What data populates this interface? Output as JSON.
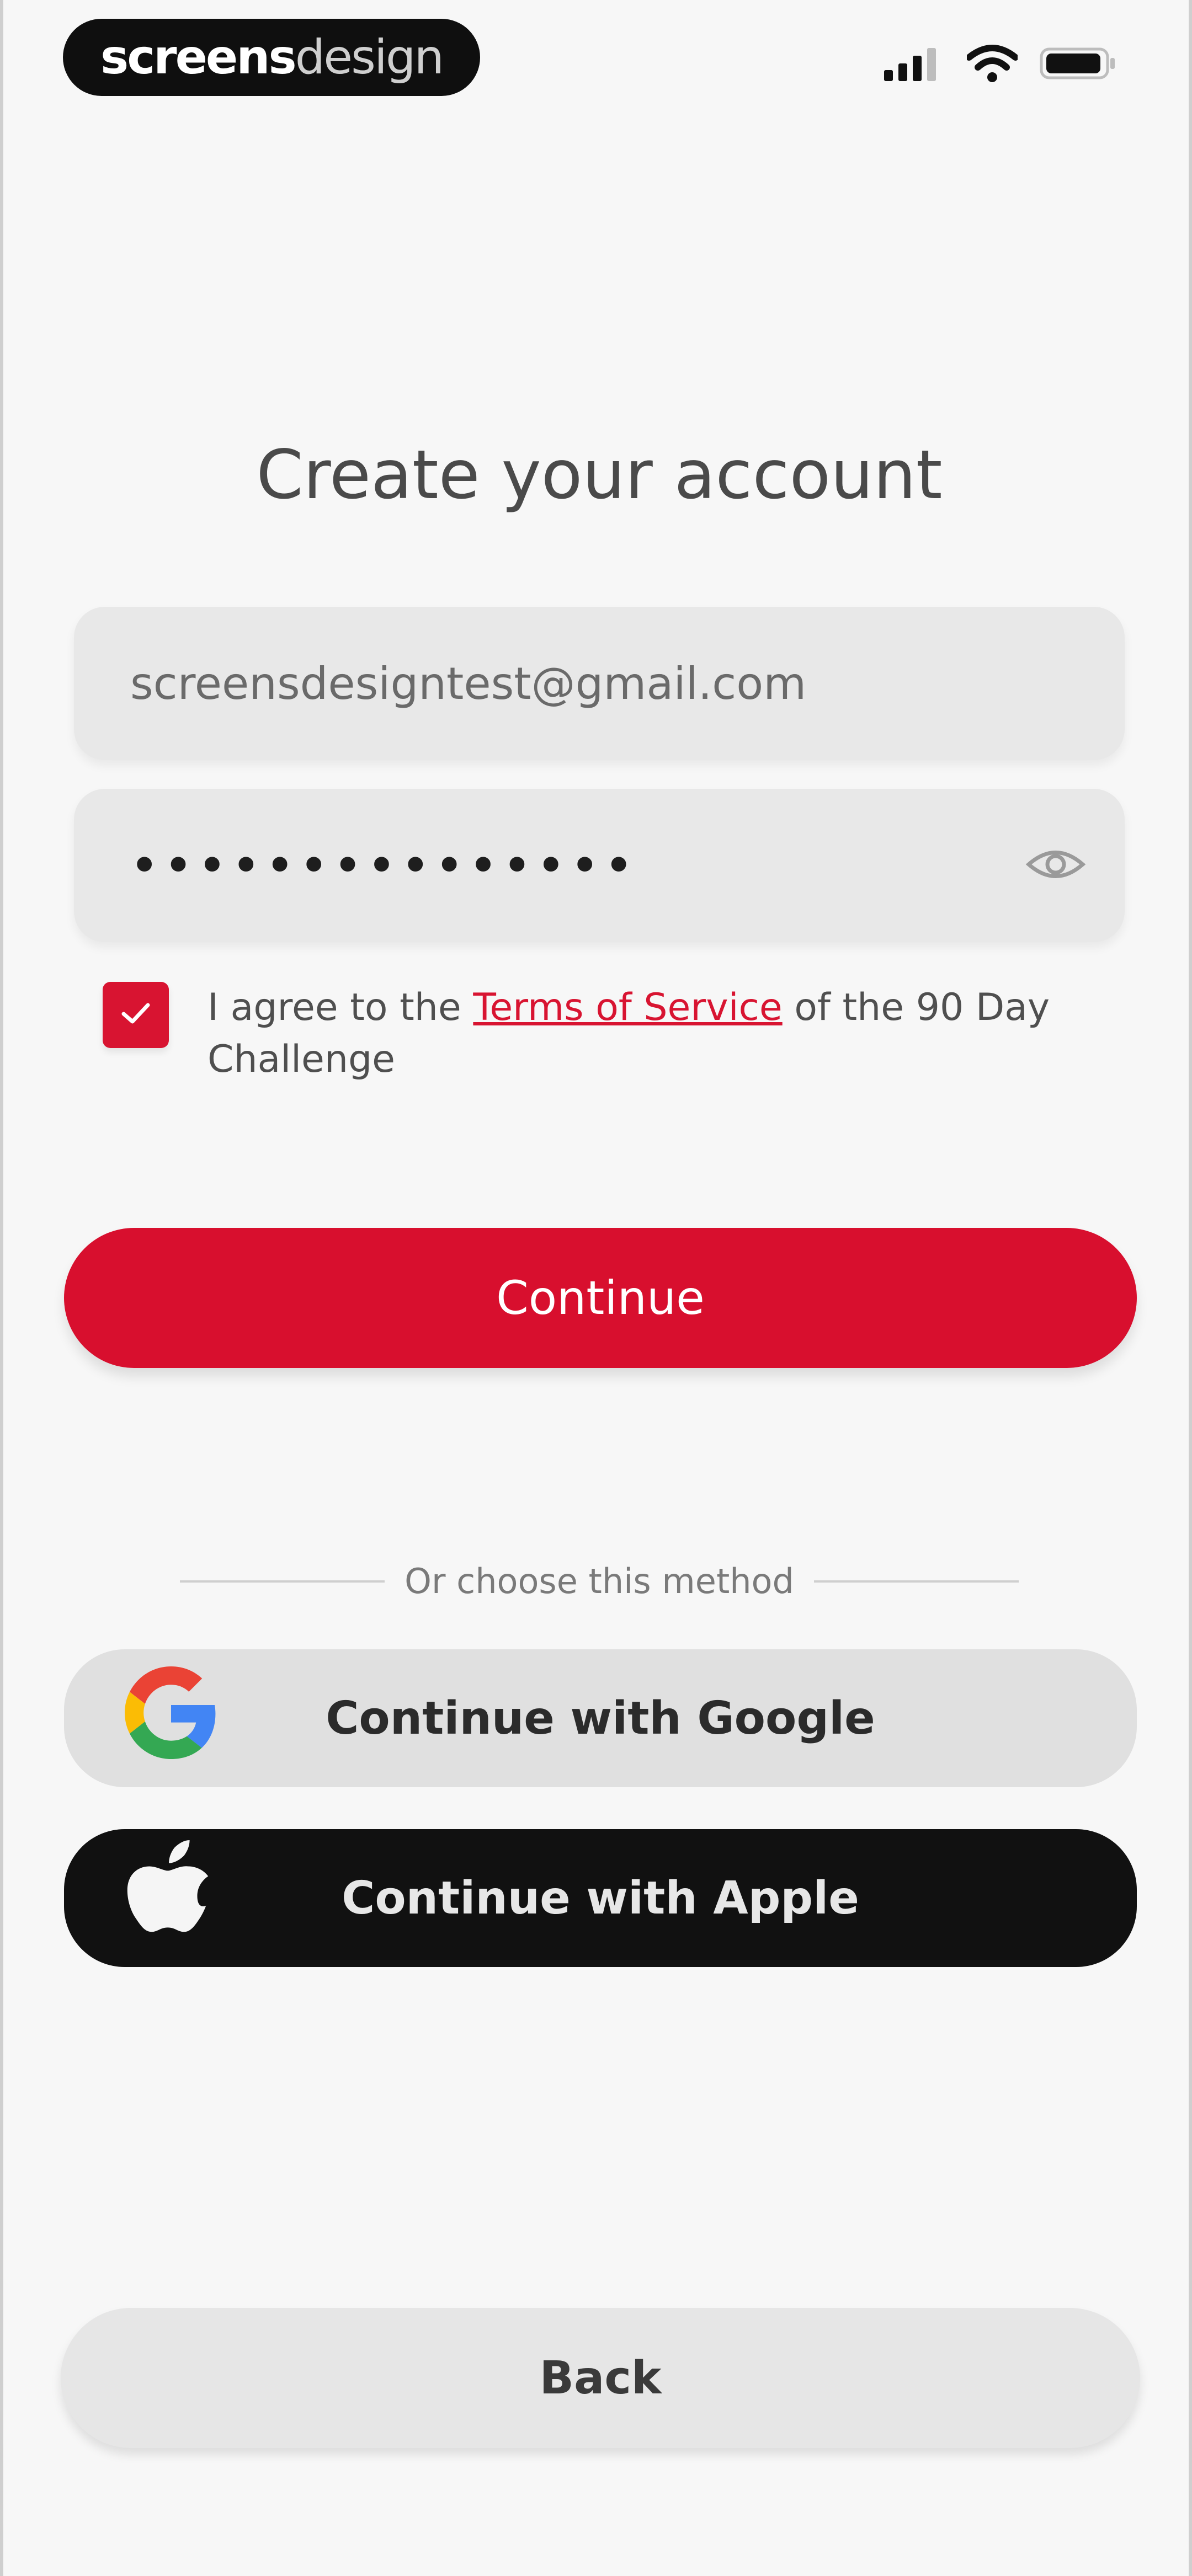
{
  "brand": {
    "bold": "screens",
    "light": "design"
  },
  "status": {
    "icons": [
      "signal-icon",
      "wifi-icon",
      "battery-icon"
    ]
  },
  "title": "Create your account",
  "form": {
    "email_value": "screensdesigntest@gmail.com",
    "password_value": "•••••••••••••••",
    "show_password_icon": "eye-icon"
  },
  "terms": {
    "checked": true,
    "prefix": "I agree to the ",
    "link": "Terms of Service",
    "suffix": " of the 90 Day Challenge"
  },
  "buttons": {
    "continue": "Continue",
    "divider": "Or choose this method",
    "google": "Continue with Google",
    "apple": "Continue with Apple",
    "back": "Back"
  },
  "colors": {
    "accent": "#d80f2e",
    "background": "#f7f7f7",
    "apple_button": "#111111",
    "google_button": "#e0e0e0"
  }
}
